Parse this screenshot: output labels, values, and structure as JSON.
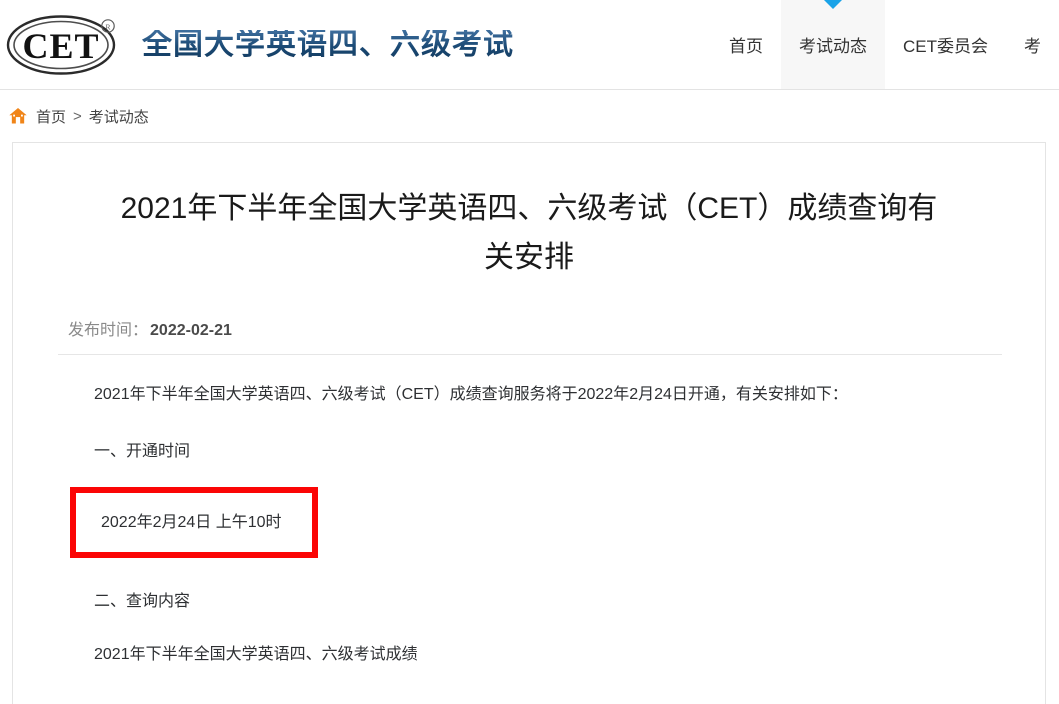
{
  "header": {
    "logo_alt": "CET",
    "logo_mark": "CET",
    "logo_registered": "®",
    "site_title": "全国大学英语四、六级考试",
    "nav": [
      {
        "label": "首页",
        "active": false
      },
      {
        "label": "考试动态",
        "active": true
      },
      {
        "label": "CET委员会",
        "active": false
      },
      {
        "label": "考",
        "active": false
      }
    ]
  },
  "breadcrumb": {
    "home_icon": "home-icon",
    "home": "首页",
    "separator": ">",
    "current": "考试动态"
  },
  "article": {
    "title": "2021年下半年全国大学英语四、六级考试（CET）成绩查询有关安排",
    "publish_label": "发布时间：",
    "publish_date": "2022-02-21",
    "paragraphs": [
      "2021年下半年全国大学英语四、六级考试（CET）成绩查询服务将于2022年2月24日开通，有关安排如下：",
      "一、开通时间"
    ],
    "highlight": {
      "text": "2022年2月24日 上午10时",
      "border_color": "#fb0505"
    },
    "paragraphs_after": [
      "二、查询内容",
      "2021年下半年全国大学英语四、六级考试成绩"
    ]
  },
  "colors": {
    "brand_blue": "#1f4e79",
    "accent_cyan": "#1aa3e8",
    "home_orange": "#f08519",
    "highlight_red": "#fb0505",
    "active_tab_bg": "#f7f7f7"
  }
}
